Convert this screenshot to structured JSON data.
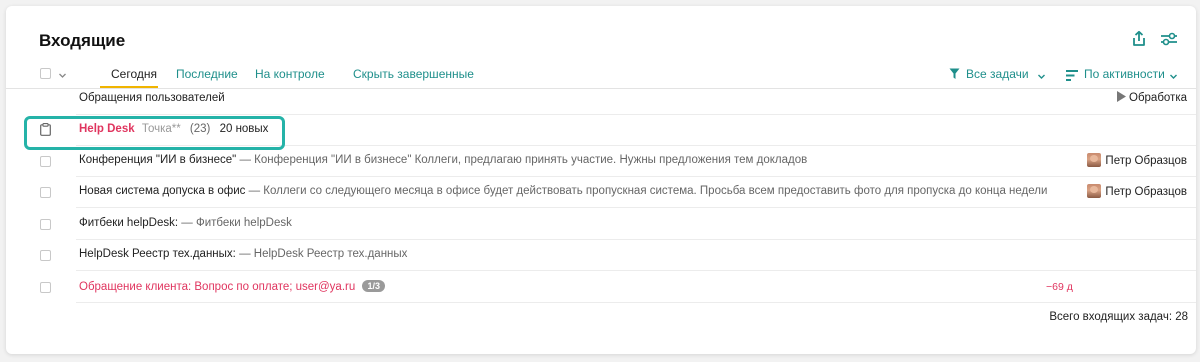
{
  "header": {
    "title": "Входящие"
  },
  "tabs": [
    {
      "label": "Сегодня",
      "active": true
    },
    {
      "label": "Последние",
      "active": false
    },
    {
      "label": "На контроле",
      "active": false
    },
    {
      "label": "Скрыть завершенные",
      "active": false
    }
  ],
  "filters": {
    "tasks_label": "Все задачи",
    "sort_label": "По активности"
  },
  "groups": [
    {
      "title": "Обращения пользователей",
      "action": "Обработка"
    },
    {
      "title": "Help Desk",
      "subtitle": "Точка**",
      "count": "(23)",
      "new_label": "20 новых"
    }
  ],
  "tasks": [
    {
      "title": "Конференция \"ИИ в бизнесе\"",
      "description": "— Конференция \"ИИ в бизнесе\" Коллеги, предлагаю принять участие. Нужны предложения тем докладов",
      "author": "Петр Образцов"
    },
    {
      "title": "Новая система допуска в офис",
      "description": "— Коллеги со следующего месяца в офисе будет действовать пропускная система. Просьба всем предоставить фото для пропуска до конца недели",
      "author": "Петр Образцов"
    },
    {
      "title": "Фитбеки helpDesk:",
      "description": "— Фитбеки helpDesk",
      "author": ""
    },
    {
      "title": "HelpDesk Реестр тех.данных:",
      "description": "— HelpDesk Реестр тех.данных",
      "author": ""
    },
    {
      "title": "Обращение клиента: Вопрос по оплате; user@ya.ru",
      "badge": "1/3",
      "overdue": "−69 д"
    }
  ],
  "footer": {
    "total": "Всего входящих задач: 28"
  },
  "colors": {
    "accent": "#1f8f8b",
    "highlight_border": "#25b3a8",
    "alert": "#e0355f",
    "tab_underline": "#f0b400"
  }
}
